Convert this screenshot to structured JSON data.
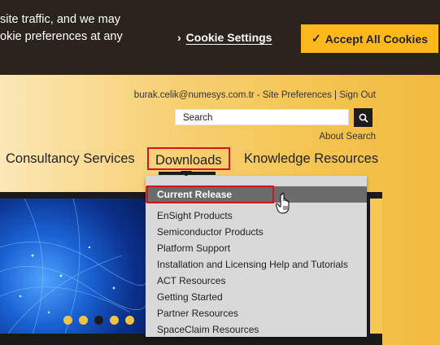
{
  "cookie_banner": {
    "text_line_1": "site traffic, and we may",
    "text_line_2": "okie preferences at any",
    "settings_label": "Cookie Settings",
    "settings_chevron": "›",
    "accept_label": "Accept All Cookies",
    "accept_check": "✓",
    "accent_color": "#ffb81c"
  },
  "header": {
    "user_email": "burak.celik@numesys.com.tr",
    "sep1": " - ",
    "site_preferences": "Site Preferences",
    "sep2": " | ",
    "sign_out": "Sign Out",
    "search_value": "Search",
    "about_search": "About Search"
  },
  "nav": {
    "items": [
      {
        "label": "Consultancy Services"
      },
      {
        "label": "Downloads"
      },
      {
        "label": "Knowledge Resources"
      }
    ]
  },
  "dropdown": {
    "items": [
      {
        "label": "Current Release"
      },
      {
        "label": "EnSight Products"
      },
      {
        "label": "Semiconductor Products"
      },
      {
        "label": "Platform Support"
      },
      {
        "label": "Installation and Licensing Help and Tutorials"
      },
      {
        "label": "ACT Resources"
      },
      {
        "label": "Getting Started"
      },
      {
        "label": "Partner Resources"
      },
      {
        "label": "SpaceClaim Resources"
      }
    ]
  },
  "icons": {
    "search": "search-icon",
    "cursor": "hand-pointer-icon"
  },
  "colors": {
    "highlight": "#d4141a",
    "banner_bg": "#2b241c"
  }
}
